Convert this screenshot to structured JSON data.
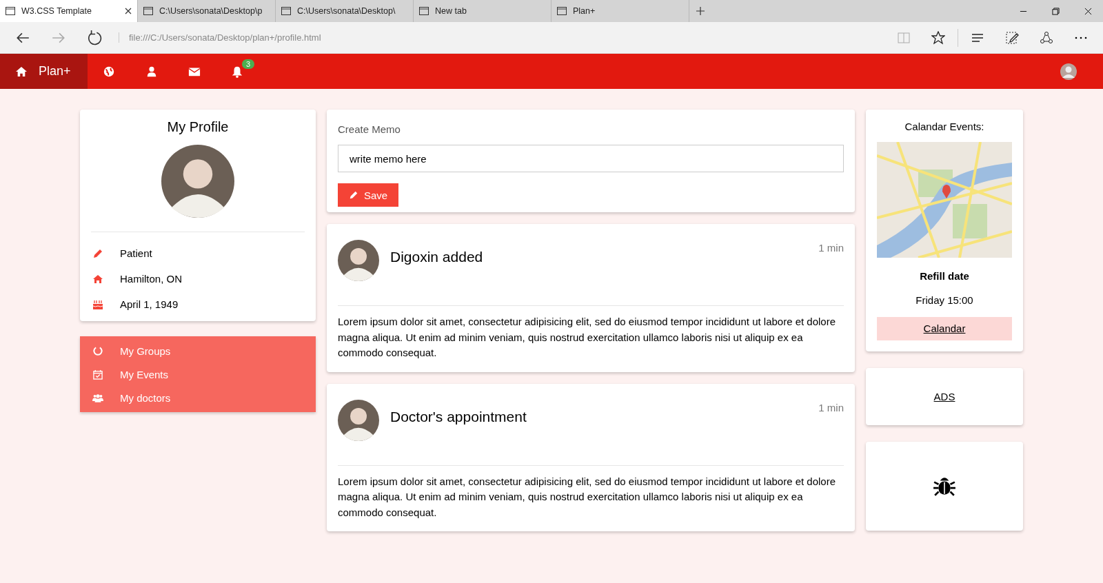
{
  "browser": {
    "tabs": [
      {
        "title": "W3.CSS Template",
        "selected": true
      },
      {
        "title": "C:\\Users\\sonata\\Desktop\\p",
        "selected": false
      },
      {
        "title": "C:\\Users\\sonata\\Desktop\\",
        "selected": false
      },
      {
        "title": "New tab",
        "selected": false
      },
      {
        "title": "Plan+",
        "selected": false
      }
    ],
    "address": "file:///C:/Users/sonata/Desktop/plan+/profile.html"
  },
  "navbar": {
    "brand": "Plan+",
    "notification_count": "3"
  },
  "profile": {
    "title": "My Profile",
    "details": [
      {
        "kind": "pencil",
        "text": "Patient"
      },
      {
        "kind": "home",
        "text": "Hamilton, ON"
      },
      {
        "kind": "cake",
        "text": "April 1, 1949"
      }
    ]
  },
  "menu": [
    {
      "kind": "circle",
      "label": "My Groups"
    },
    {
      "kind": "calendar",
      "label": "My Events"
    },
    {
      "kind": "group",
      "label": "My doctors"
    }
  ],
  "memo": {
    "title": "Create Memo",
    "value": "write memo here",
    "button": "Save"
  },
  "posts": [
    {
      "title": "Digoxin added",
      "time": "1 min",
      "body": "Lorem ipsum dolor sit amet, consectetur adipisicing elit, sed do eiusmod tempor incididunt ut labore et dolore magna aliqua. Ut enim ad minim veniam, quis nostrud exercitation ullamco laboris nisi ut aliquip ex ea commodo consequat."
    },
    {
      "title": "Doctor's appointment",
      "time": "1 min",
      "body": "Lorem ipsum dolor sit amet, consectetur adipisicing elit, sed do eiusmod tempor incididunt ut labore et dolore magna aliqua. Ut enim ad minim veniam, quis nostrud exercitation ullamco laboris nisi ut aliquip ex ea commodo consequat."
    }
  ],
  "calendar": {
    "title": "Calandar Events:",
    "heading": "Refill date",
    "time": "Friday 15:00",
    "link": "Calandar"
  },
  "ads": {
    "link": "ADS"
  }
}
